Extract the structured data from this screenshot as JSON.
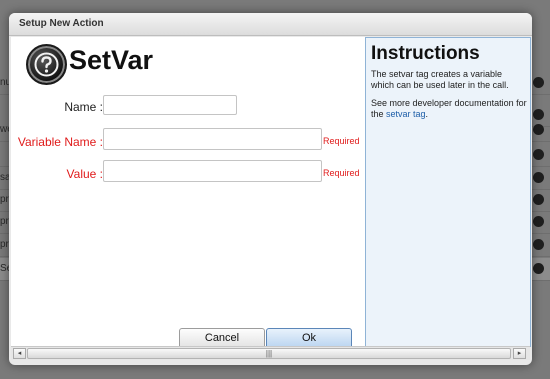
{
  "background": {
    "fragments": [
      "nu",
      "we",
      "sa",
      "pr",
      "pr",
      "pr",
      "Se"
    ]
  },
  "dialog": {
    "title": "Setup New Action",
    "heading": "SetVar",
    "logo_icon": "question-mark-icon",
    "fields": {
      "name": {
        "label": "Name :",
        "value": "",
        "placeholder": ""
      },
      "variable_name": {
        "label": "Variable Name :",
        "value": "",
        "placeholder": "",
        "required_text": "Required"
      },
      "value": {
        "label": "Value :",
        "value": "",
        "placeholder": "",
        "required_text": "Required"
      }
    },
    "buttons": {
      "cancel": "Cancel",
      "ok": "Ok"
    },
    "instructions": {
      "title": "Instructions",
      "text1": "The setvar tag creates a variable which can be used later in the call.",
      "text2_prefix": "See more developer documentation for the ",
      "text2_link": "setvar tag",
      "text2_suffix": "."
    },
    "scrollbar": {
      "left_arrow": "◂",
      "right_arrow": "▸",
      "thumb_grip": "|||"
    }
  },
  "colors": {
    "required": "#e01b1b",
    "link": "#1d5ea8",
    "instructions_bg": "#ecf3fa",
    "ok_button": "#b9d4f0"
  }
}
